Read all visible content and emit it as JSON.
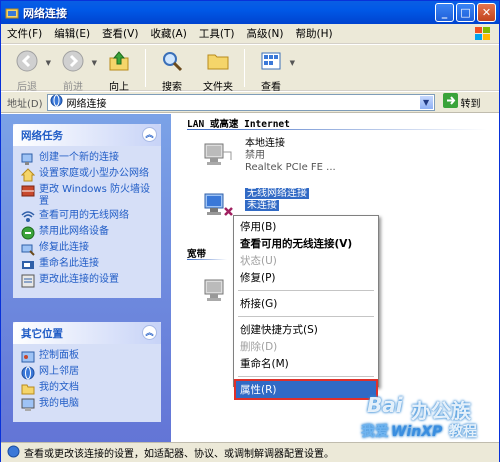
{
  "window": {
    "title": "网络连接"
  },
  "menu": [
    "文件(F)",
    "编辑(E)",
    "查看(V)",
    "收藏(A)",
    "工具(T)",
    "高级(N)",
    "帮助(H)"
  ],
  "toolbar": {
    "back": "后退",
    "forward": "前进",
    "up": "向上",
    "search": "搜索",
    "folders": "文件夹",
    "view": "查看"
  },
  "address": {
    "label": "地址(D)",
    "value": "网络连接",
    "go": "转到"
  },
  "tasks": {
    "title": "网络任务",
    "items": [
      "创建一个新的连接",
      "设置家庭或小型办公网络",
      "更改 Windows 防火墙设置",
      "查看可用的无线网络",
      "禁用此网络设备",
      "修复此连接",
      "重命名此连接",
      "更改此连接的设置"
    ]
  },
  "places": {
    "title": "其它位置",
    "items": [
      "控制面板",
      "网上邻居",
      "我的文档",
      "我的电脑"
    ]
  },
  "content": {
    "group1": "LAN 或高速 Internet",
    "group2": "宽带",
    "conn1": {
      "name": "本地连接",
      "status": "禁用",
      "device": "Realtek PCIe FE ..."
    },
    "conn2": {
      "name": "无线网络连接",
      "status": "未连接"
    }
  },
  "context_menu": {
    "items": [
      {
        "label": "停用(B)",
        "style": "normal"
      },
      {
        "label": "查看可用的无线连接(V)",
        "style": "bold"
      },
      {
        "label": "状态(U)",
        "style": "disabled"
      },
      {
        "label": "修复(P)",
        "style": "normal"
      },
      {
        "label": "桥接(G)",
        "style": "normal"
      },
      {
        "label": "创建快捷方式(S)",
        "style": "normal"
      },
      {
        "label": "删除(D)",
        "style": "disabled"
      },
      {
        "label": "重命名(M)",
        "style": "normal"
      },
      {
        "label": "属性(R)",
        "style": "highlighted"
      }
    ]
  },
  "status": {
    "text": "查看或更改该连接的设置，如适配器、协议、或调制解调器配置设置。"
  },
  "watermark": {
    "line1": "Bai",
    "line2": "办公族",
    "line3": "我爱",
    "line4": "WinXP",
    "line5": "教程"
  },
  "colors": {
    "title_blue": "#0058e6",
    "task_blue": "#215dc6",
    "selection": "#316ac5",
    "highlight_border": "#e0302a"
  }
}
